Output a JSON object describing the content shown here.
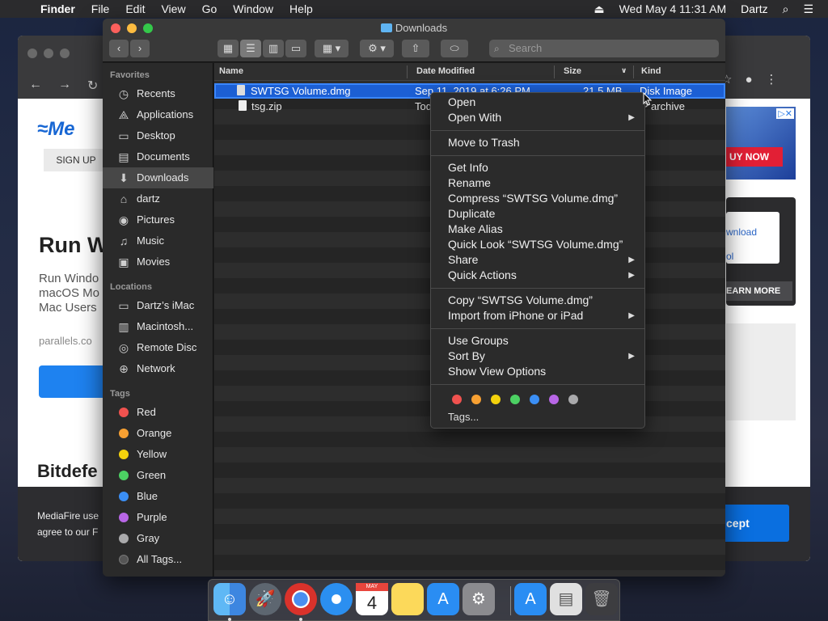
{
  "menubar": {
    "app": "Finder",
    "items": [
      "File",
      "Edit",
      "View",
      "Go",
      "Window",
      "Help"
    ],
    "datetime": "Wed May 4  11:31 AM",
    "user": "Dartz"
  },
  "browser": {
    "signup": "SIGN UP",
    "headline": "Run W",
    "desc": "Run Windo macOS Mo Mac Users",
    "parallels": "parallels.co",
    "bitdef": "Bitdefe",
    "cookie_text": "MediaFire use agree to our F",
    "accept": "cept",
    "ad_buy": "UY NOW",
    "dl_text_1": "wnload",
    "dl_text_2": "ol",
    "learn": "EARN MORE"
  },
  "finder": {
    "title": "Downloads",
    "search_placeholder": "Search",
    "sidebar": {
      "favorites_header": "Favorites",
      "favorites": [
        {
          "label": "Recents",
          "icon": "clock-icon"
        },
        {
          "label": "Applications",
          "icon": "applications-icon"
        },
        {
          "label": "Desktop",
          "icon": "desktop-icon"
        },
        {
          "label": "Documents",
          "icon": "documents-icon"
        },
        {
          "label": "Downloads",
          "icon": "downloads-icon"
        },
        {
          "label": "dartz",
          "icon": "home-icon"
        },
        {
          "label": "Pictures",
          "icon": "camera-icon"
        },
        {
          "label": "Music",
          "icon": "music-icon"
        },
        {
          "label": "Movies",
          "icon": "film-icon"
        }
      ],
      "locations_header": "Locations",
      "locations": [
        {
          "label": "Dartz’s iMac",
          "icon": "imac-icon"
        },
        {
          "label": "Macintosh...",
          "icon": "disk-icon"
        },
        {
          "label": "Remote Disc",
          "icon": "disc-icon"
        },
        {
          "label": "Network",
          "icon": "globe-icon"
        }
      ],
      "tags_header": "Tags",
      "tags": [
        {
          "label": "Red",
          "color": "#f0524f"
        },
        {
          "label": "Orange",
          "color": "#f7a032"
        },
        {
          "label": "Yellow",
          "color": "#f4d20c"
        },
        {
          "label": "Green",
          "color": "#4cd163"
        },
        {
          "label": "Blue",
          "color": "#3b8ff5"
        },
        {
          "label": "Purple",
          "color": "#b866e6"
        },
        {
          "label": "Gray",
          "color": "#a9a9ab"
        },
        {
          "label": "All Tags...",
          "color": "#555555"
        }
      ]
    },
    "columns": {
      "name": "Name",
      "date": "Date Modified",
      "size": "Size",
      "kind": "Kind"
    },
    "files": [
      {
        "name": "SWTSG Volume.dmg",
        "date": "Sep 11, 2019 at 6:26 PM",
        "size": "21.5 MB",
        "kind": "Disk Image"
      },
      {
        "name": "tsg.zip",
        "date": "Tod",
        "size": "",
        "kind": "P archive"
      }
    ]
  },
  "context_menu": {
    "items": [
      "Open",
      "Open With",
      "Move to Trash",
      "Get Info",
      "Rename",
      "Compress “SWTSG Volume.dmg”",
      "Duplicate",
      "Make Alias",
      "Quick Look “SWTSG Volume.dmg”",
      "Share",
      "Quick Actions",
      "Copy “SWTSG Volume.dmg”",
      "Import from iPhone or iPad",
      "Use Groups",
      "Sort By",
      "Show View Options"
    ],
    "tags_label": "Tags...",
    "tag_colors": [
      "#f0524f",
      "#f7a032",
      "#f4d20c",
      "#4cd163",
      "#3b8ff5",
      "#b866e6",
      "#a9a9ab"
    ]
  },
  "dock": {
    "icons": [
      "finder-icon",
      "launchpad-icon",
      "chrome-icon",
      "safari-icon",
      "calendar-icon",
      "notes-icon",
      "app-store-icon",
      "system-preferences-icon",
      "applications-folder-icon",
      "document-icon",
      "trash-icon"
    ],
    "calendar_month": "MAY",
    "calendar_day": "4"
  }
}
